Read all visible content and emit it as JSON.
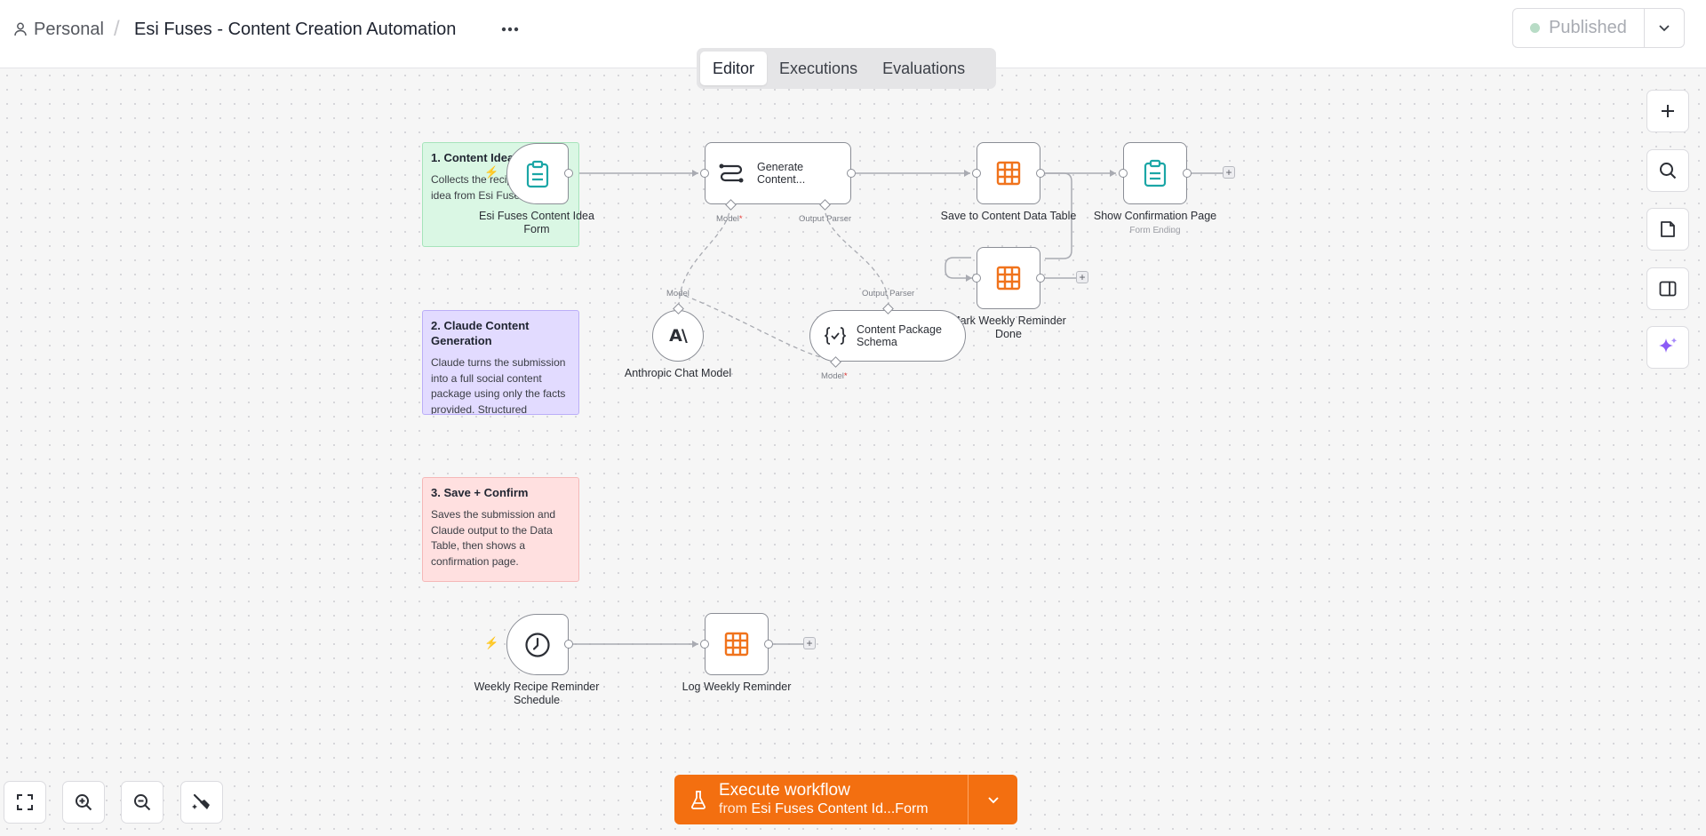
{
  "header": {
    "workspace": "Personal",
    "separator": "/",
    "workflow_title": "Esi Fuses - Content Creation Automation",
    "more_icon": "ellipsis-icon",
    "publish_label": "Published",
    "publish_status_color": "#b8dcc6"
  },
  "tabs": [
    {
      "label": "Editor",
      "active": true
    },
    {
      "label": "Executions",
      "active": false
    },
    {
      "label": "Evaluations",
      "active": false
    }
  ],
  "sticky_notes": [
    {
      "title": "1. Content Idea",
      "body": "Collects the recipe content idea from Esi Fuses team.",
      "color": "#daf7e4"
    },
    {
      "title": "2. Claude Content Generation",
      "body": "Claude turns the submission into a full social content package using only the facts provided. Structured",
      "color": "#e2dbff"
    },
    {
      "title": "3. Save + Confirm",
      "body": "Saves the submission and Claude output to the Data Table, then shows a confirmation page.",
      "color": "#ffe0e0"
    }
  ],
  "nodes": {
    "form": {
      "label": "Esi Fuses Content Idea Form",
      "icon": "clipboard-icon"
    },
    "generate": {
      "label": "Generate Content...",
      "icon": "chain-icon"
    },
    "save_table": {
      "label": "Save to Content Data Table",
      "icon": "table-icon"
    },
    "confirm": {
      "label": "Show Confirmation Page",
      "sub": "Form Ending",
      "icon": "clipboard-icon"
    },
    "mark_done": {
      "label": "Mark Weekly Reminder Done",
      "icon": "table-icon"
    },
    "anthropic": {
      "label": "Anthropic Chat Model",
      "icon": "anthropic-icon"
    },
    "schema": {
      "label": "Content Package Schema",
      "icon": "braces-check-icon"
    },
    "schedule": {
      "label": "Weekly Recipe Reminder Schedule",
      "icon": "clock-icon"
    },
    "log": {
      "label": "Log Weekly Reminder",
      "icon": "table-icon"
    }
  },
  "connection_labels": {
    "model": "Model",
    "output_parser": "Output Parser",
    "required_mark": "*"
  },
  "side_toolbar": [
    "plus-icon",
    "search-icon",
    "sticky-note-icon",
    "panel-icon",
    "ai-sparkle-icon"
  ],
  "zoom_toolbar": [
    "fit-view-icon",
    "zoom-in-icon",
    "zoom-out-icon",
    "tidy-up-icon"
  ],
  "execute": {
    "label": "Execute workflow",
    "from_prefix": "from",
    "from_node": "Esi Fuses Content Id...Form",
    "color": "#f36f10"
  }
}
